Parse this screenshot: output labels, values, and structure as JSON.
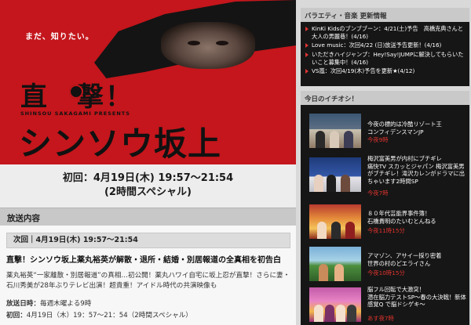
{
  "hero": {
    "tagline": "まだ、知りたい。",
    "title_line1": "直　撃！",
    "presents": "SHINSOU SAKAGAMI PRESENTS",
    "title_line2": "シンソウ坂上"
  },
  "airinfo": {
    "line1": "初回：4月19日(木) 19:57～21:54",
    "line2": "(2時間スペシャル)"
  },
  "broadcast": {
    "section_title": "放送内容",
    "episode_bar": "次回｜4月19日(木) 19:57～21:54",
    "episode_title": "直撃！シンソウ坂上薬丸裕英が解散・退所・結婚・別居報道の全真相を初告白",
    "episode_desc": "薬丸裕英“一家離散・別居報道”の真相…初公開！薬丸ハワイ自宅に坂上忍が直撃！さらに妻・石川秀美が28年ぶりテレビ出演！超貴重！アイドル時代の共演映像も",
    "day_label": "放送日時：",
    "day_value": "毎週木曜よる9時",
    "first_label": "初回：",
    "first_value": "4月19日（木）19：57～21：54（2時間スペシャル）"
  },
  "news": {
    "title": "バラエティ・音楽 更新情報",
    "items": [
      "KinKi Kidsのブンブブーン：4/21(土)予告　高橋克典さんと大人の男麗巷！(4/16)",
      "Love music：次回4/22 (日)放送予告更新！(4/16)",
      "いただきハイジャンプ：Hey!Say!JUMPに解決してもらいたいこと募集中！(4/16)",
      "VS嵐：次回4/19(木)予告を更新★(4/12)"
    ]
  },
  "picks": {
    "title": "今日のイチオシ！",
    "items": [
      {
        "title": "今夜の標的は冷酷リゾート王\nコンフィデンスマンJP",
        "time": "今夜9時"
      },
      {
        "title": "梅沢富美男が内村にブチギレ\n痛快TV スカッとジャパン 梅沢富美男がブチギレ！滝沢カレンがドラマに出ちゃいます2時間SP",
        "time": "今夜7時"
      },
      {
        "title": "８０年代芸能界事件簿！\n石橋貴明のたいむとんねる",
        "time": "今夜11時15分"
      },
      {
        "title": "アマゾン、アサイー採り密着\n世界の村のどエライさん",
        "time": "今夜10時15分"
      },
      {
        "title": "脳フル回転で大激突！\n潜在脳力テストSP～春の大決戦！新体感覚Q で脳ドシゲキ～",
        "time": "あす夜7時"
      }
    ]
  },
  "colors": {
    "hero_red": "#c4161c",
    "time_red": "#e0342e",
    "panel_dark": "#161616"
  }
}
